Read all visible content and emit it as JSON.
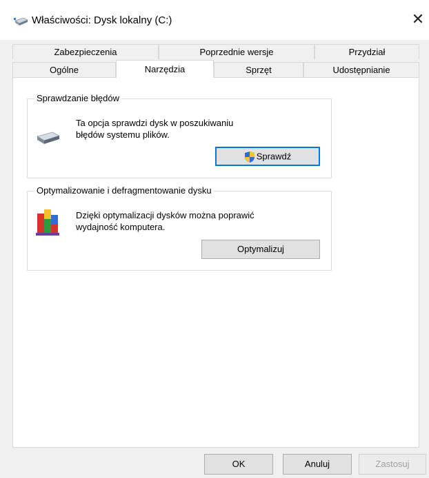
{
  "window": {
    "title": "Właściwości: Dysk lokalny (C:)",
    "close_symbol": "✕"
  },
  "tabs": {
    "row1": [
      {
        "label": "Zabezpieczenia"
      },
      {
        "label": "Poprzednie wersje"
      },
      {
        "label": "Przydział"
      }
    ],
    "row2": [
      {
        "label": "Ogólne"
      },
      {
        "label": "Narzędzia",
        "active": true
      },
      {
        "label": "Sprzęt"
      },
      {
        "label": "Udostępnianie"
      }
    ]
  },
  "error_check": {
    "title": "Sprawdzanie błędów",
    "description_line1": "Ta opcja sprawdzi dysk w poszukiwaniu",
    "description_line2": "błędów systemu plików.",
    "button_label": "Sprawdź",
    "icon": "drive-icon",
    "button_icon": "uac-shield-icon"
  },
  "optimize": {
    "title": "Optymalizowanie i defragmentowanie dysku",
    "description_line1": "Dzięki optymalizacji dysków można poprawić",
    "description_line2": "wydajność komputera.",
    "button_label": "Optymalizuj",
    "icon": "defrag-icon"
  },
  "footer": {
    "ok_label": "OK",
    "cancel_label": "Anuluj",
    "apply_label": "Zastosuj"
  },
  "colors": {
    "focus_border": "#0078d7",
    "window_bg": "#f0f0f0"
  }
}
